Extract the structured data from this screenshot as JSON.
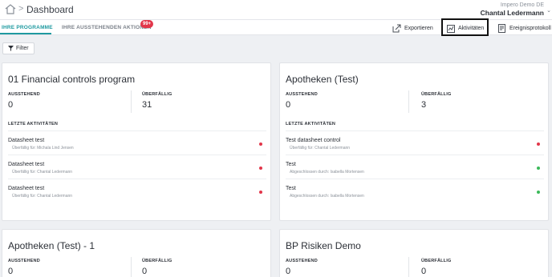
{
  "header": {
    "page_title": "Dashboard",
    "breadcrumb_separator": ">",
    "user_org": "Impero Demo DE",
    "user_name": "Chantal Ledermann"
  },
  "tabs": {
    "programs": "IHRE PROGRAMME",
    "pending": "IHRE AUSSTEHENDEN AKTIONEN",
    "pending_badge": "99+"
  },
  "actions": {
    "export": "Exportieren",
    "activities": "Aktivitäten",
    "event_log": "Ereignisprotokoll"
  },
  "filter_label": "Filter",
  "colors": {
    "accent": "#1f9aa0",
    "badge": "#e2364a",
    "status_red": "#e2364a",
    "status_green": "#3cb95a"
  },
  "cards": [
    {
      "title": "01 Financial controls program",
      "pending_label": "AUSSTEHEND",
      "pending_value": "0",
      "overdue_label": "ÜBERFÄLLIG",
      "overdue_value": "31",
      "activities_label": "LETZTE AKTIVITÄTEN",
      "activities": [
        {
          "name": "Datasheet test",
          "sub": "Überfällig für: Michala Lind Jensen",
          "status": "red"
        },
        {
          "name": "Datasheet test",
          "sub": "Überfällig für: Chantal Ledermann",
          "status": "red"
        },
        {
          "name": "Datasheet test",
          "sub": "Überfällig für: Chantal Ledermann",
          "status": "red"
        }
      ]
    },
    {
      "title": "Apotheken (Test)",
      "pending_label": "AUSSTEHEND",
      "pending_value": "0",
      "overdue_label": "ÜBERFÄLLIG",
      "overdue_value": "3",
      "activities_label": "LETZTE AKTIVITÄTEN",
      "activities": [
        {
          "name": "Test datasheet control",
          "sub": "Überfällig für: Chantal Ledermann",
          "status": "red"
        },
        {
          "name": "Test",
          "sub": "Abgeschlossen durch: Isabella Mortensen",
          "status": "green"
        },
        {
          "name": "Test",
          "sub": "Abgeschlossen durch: Isabella Mortensen",
          "status": "green"
        }
      ]
    },
    {
      "title": "Apotheken (Test) - 1",
      "pending_label": "AUSSTEHEND",
      "pending_value": "0",
      "overdue_label": "ÜBERFÄLLIG",
      "overdue_value": "0"
    },
    {
      "title": "BP Risiken Demo",
      "pending_label": "AUSSTEHEND",
      "pending_value": "0",
      "overdue_label": "ÜBERFÄLLIG",
      "overdue_value": "0"
    }
  ]
}
